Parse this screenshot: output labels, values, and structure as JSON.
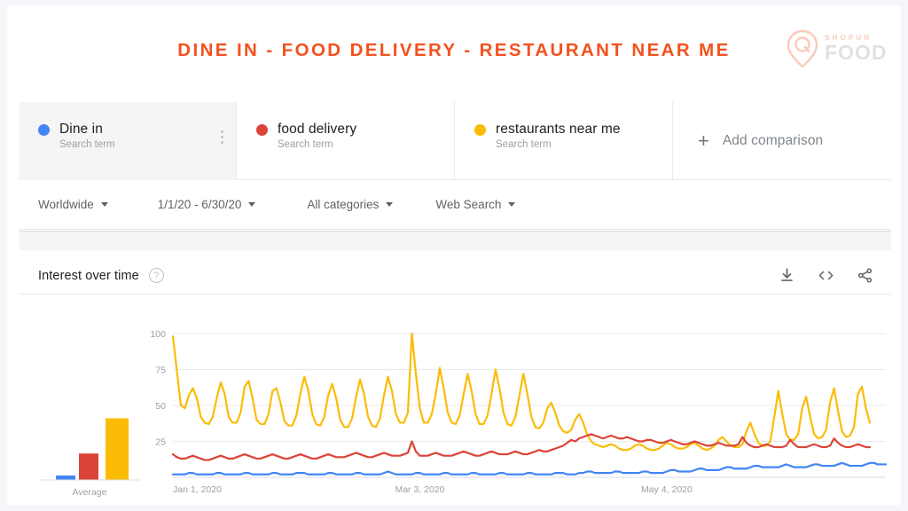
{
  "page": {
    "title": "DINE IN - FOOD DELIVERY - RESTAURANT NEAR ME",
    "title_color": "#F4511E"
  },
  "logo": {
    "top_text": "SHOPUR",
    "main_text": "FOOD",
    "icon": "map-pin-icon"
  },
  "terms": [
    {
      "label": "Dine in",
      "sublabel": "Search term",
      "color": "#4285F4",
      "selected": true
    },
    {
      "label": "food delivery",
      "sublabel": "Search term",
      "color": "#DB4437",
      "selected": false
    },
    {
      "label": "restaurants near me",
      "sublabel": "Search term",
      "color": "#FBBC05",
      "selected": false
    }
  ],
  "add_comparison": {
    "plus": "+",
    "label": "Add comparison"
  },
  "filters": [
    {
      "label": "Worldwide"
    },
    {
      "label": "1/1/20 - 6/30/20"
    },
    {
      "label": "All categories"
    },
    {
      "label": "Web Search"
    }
  ],
  "interest_over_time": {
    "title": "Interest over time",
    "help": "?",
    "actions": [
      "download-icon",
      "embed-icon",
      "share-icon"
    ]
  },
  "chart_data": {
    "type": "line",
    "title": "Interest over time",
    "xlabel": "",
    "ylabel": "",
    "ylim": [
      0,
      100
    ],
    "yticks": [
      25,
      50,
      75,
      100
    ],
    "grid": true,
    "legend_position": "top",
    "x_tick_labels": [
      "Jan 1, 2020",
      "Mar 3, 2020",
      "May 4, 2020"
    ],
    "x_tick_positions": [
      0,
      62,
      124
    ],
    "x_start": "Jan 1, 2020",
    "x_end": "Jun 30, 2020",
    "n_points": 182,
    "series": [
      {
        "name": "Dine in",
        "color": "#4285F4",
        "values": [
          2,
          2,
          2,
          2,
          3,
          3,
          2,
          2,
          2,
          2,
          2,
          3,
          3,
          2,
          2,
          2,
          2,
          2,
          3,
          3,
          2,
          2,
          2,
          2,
          2,
          3,
          3,
          2,
          2,
          2,
          2,
          3,
          3,
          3,
          2,
          2,
          2,
          2,
          2,
          3,
          3,
          2,
          2,
          2,
          2,
          2,
          3,
          3,
          2,
          2,
          2,
          2,
          2,
          3,
          4,
          3,
          2,
          2,
          2,
          2,
          2,
          3,
          3,
          2,
          2,
          2,
          2,
          2,
          3,
          3,
          2,
          2,
          2,
          2,
          2,
          3,
          3,
          2,
          2,
          2,
          2,
          2,
          3,
          3,
          2,
          2,
          2,
          2,
          2,
          3,
          3,
          2,
          2,
          2,
          2,
          2,
          3,
          3,
          3,
          2,
          2,
          2,
          3,
          3,
          4,
          4,
          3,
          3,
          3,
          3,
          3,
          4,
          4,
          3,
          3,
          3,
          3,
          3,
          4,
          4,
          3,
          3,
          3,
          3,
          4,
          5,
          5,
          4,
          4,
          4,
          4,
          5,
          6,
          6,
          5,
          5,
          5,
          5,
          6,
          7,
          7,
          6,
          6,
          6,
          6,
          7,
          8,
          8,
          7,
          7,
          7,
          7,
          7,
          8,
          9,
          8,
          7,
          7,
          7,
          7,
          8,
          9,
          9,
          8,
          8,
          8,
          8,
          9,
          10,
          9,
          8,
          8,
          8,
          8,
          9,
          10,
          10,
          9,
          9,
          9
        ]
      },
      {
        "name": "food delivery",
        "color": "#DB4437",
        "values": [
          16,
          14,
          13,
          13,
          14,
          15,
          14,
          13,
          12,
          12,
          13,
          14,
          15,
          14,
          13,
          13,
          14,
          15,
          16,
          15,
          14,
          13,
          13,
          14,
          15,
          16,
          15,
          14,
          13,
          13,
          14,
          15,
          16,
          15,
          14,
          13,
          13,
          14,
          15,
          16,
          15,
          14,
          14,
          14,
          15,
          16,
          17,
          16,
          15,
          14,
          14,
          15,
          16,
          17,
          16,
          15,
          15,
          15,
          16,
          17,
          25,
          18,
          15,
          15,
          15,
          16,
          17,
          16,
          15,
          15,
          15,
          16,
          17,
          18,
          17,
          16,
          15,
          15,
          16,
          17,
          18,
          17,
          16,
          16,
          16,
          17,
          18,
          17,
          16,
          16,
          17,
          18,
          19,
          18,
          18,
          19,
          20,
          21,
          22,
          24,
          26,
          25,
          27,
          28,
          29,
          30,
          29,
          28,
          27,
          28,
          29,
          28,
          27,
          27,
          28,
          27,
          26,
          25,
          25,
          26,
          26,
          25,
          24,
          24,
          25,
          26,
          25,
          24,
          23,
          23,
          24,
          25,
          24,
          23,
          22,
          22,
          23,
          24,
          23,
          22,
          22,
          22,
          23,
          28,
          24,
          22,
          21,
          21,
          22,
          23,
          22,
          21,
          21,
          21,
          22,
          26,
          23,
          21,
          21,
          21,
          22,
          23,
          22,
          21,
          21,
          22,
          27,
          24,
          22,
          21,
          21,
          22,
          23,
          22,
          21,
          21
        ]
      },
      {
        "name": "restaurants near me",
        "color": "#FBBC05",
        "values": [
          98,
          74,
          50,
          48,
          57,
          62,
          55,
          42,
          38,
          37,
          42,
          55,
          66,
          58,
          42,
          38,
          38,
          45,
          63,
          67,
          55,
          40,
          37,
          37,
          44,
          60,
          62,
          52,
          39,
          36,
          36,
          43,
          58,
          70,
          60,
          44,
          37,
          36,
          42,
          57,
          65,
          55,
          40,
          35,
          35,
          41,
          56,
          68,
          58,
          42,
          36,
          35,
          41,
          57,
          70,
          60,
          44,
          38,
          38,
          45,
          100,
          72,
          48,
          38,
          38,
          44,
          58,
          76,
          62,
          45,
          38,
          37,
          43,
          58,
          72,
          60,
          44,
          37,
          37,
          43,
          58,
          75,
          62,
          45,
          37,
          36,
          42,
          57,
          72,
          58,
          42,
          35,
          34,
          38,
          48,
          52,
          45,
          36,
          32,
          31,
          33,
          40,
          44,
          38,
          30,
          25,
          23,
          22,
          21,
          22,
          23,
          22,
          20,
          19,
          19,
          20,
          22,
          23,
          22,
          20,
          19,
          19,
          20,
          22,
          24,
          23,
          21,
          20,
          20,
          21,
          23,
          24,
          22,
          20,
          19,
          20,
          22,
          26,
          28,
          25,
          22,
          21,
          21,
          23,
          32,
          38,
          30,
          24,
          22,
          22,
          25,
          42,
          60,
          44,
          30,
          26,
          26,
          30,
          48,
          56,
          42,
          30,
          27,
          28,
          33,
          52,
          62,
          46,
          32,
          28,
          29,
          35,
          58,
          63,
          48,
          38
        ]
      }
    ],
    "average_bars": {
      "label": "Average",
      "categories": [
        "Dine in",
        "food delivery",
        "restaurants near me"
      ],
      "values": [
        3,
        18,
        42
      ],
      "colors": [
        "#4285F4",
        "#DB4437",
        "#FBBC05"
      ]
    }
  }
}
